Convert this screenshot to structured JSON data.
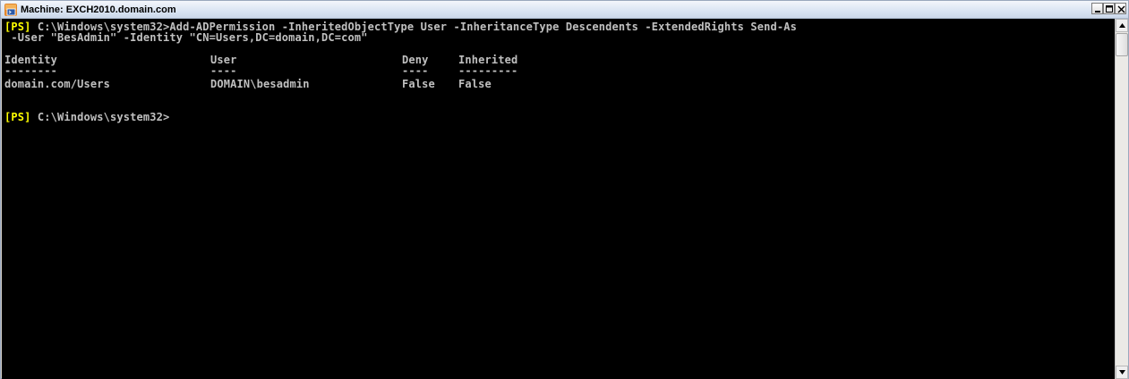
{
  "window": {
    "title": "Machine: EXCH2010.domain.com"
  },
  "console": {
    "command_prompt": "[PS]",
    "command_path": " C:\\Windows\\system32>",
    "command_text": "Add-ADPermission -InheritedObjectType User -InheritanceType Descendents -ExtendedRights Send-As",
    "command_continuation": " -User \"BesAdmin\" -Identity \"CN=Users,DC=domain,DC=com\"",
    "table": {
      "headers": [
        "Identity",
        "User",
        "Deny",
        "Inherited"
      ],
      "underlines": [
        "--------",
        "----",
        "----",
        "---------"
      ],
      "rows": [
        [
          "domain.com/Users",
          "DOMAIN\\besadmin",
          "False",
          "False"
        ]
      ]
    },
    "prompt_prefix": "[PS]",
    "prompt_path": " C:\\Windows\\system32>"
  },
  "colors": {
    "background": "#000000",
    "text": "#c0c0c0",
    "ps_tag": "#ffff00"
  },
  "icons": {
    "app": "powershell-console-icon",
    "minimize": "minimize-icon",
    "maximize": "maximize-icon",
    "close": "close-icon",
    "scroll_up": "scroll-up-arrow-icon",
    "scroll_down": "scroll-down-arrow-icon"
  }
}
